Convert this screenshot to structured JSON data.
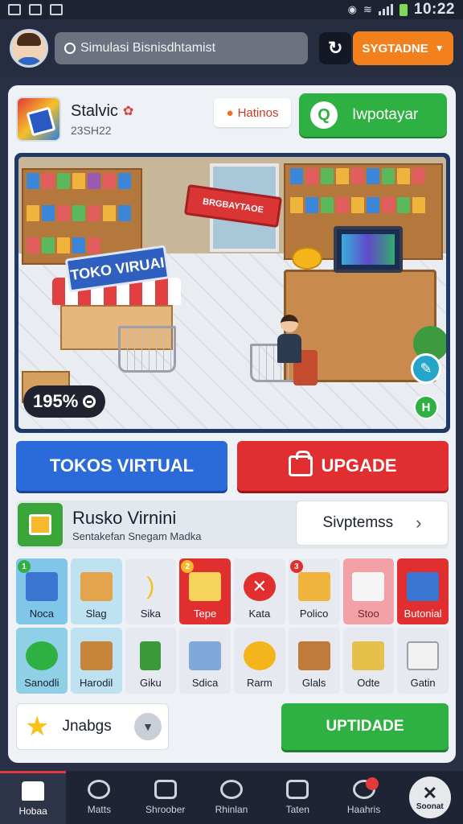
{
  "status": {
    "time": "10:22"
  },
  "topbar": {
    "search_text": "Simulasi Bisnisdhtamist",
    "sync_label": "SYGTADNE"
  },
  "app": {
    "name": "Stalvic",
    "sub": "23SH22",
    "hatinos_label": "Hatinos",
    "support_label": "Iwpotayar"
  },
  "scene": {
    "kiosk_sign": "TOKO VIRUAI",
    "red_sign": "BRGBAYTAOE",
    "progress_text": "195%"
  },
  "actions": {
    "tokos_label": "TOKOS VIRTUAL",
    "upgade_label": "UPGADE"
  },
  "info": {
    "title": "Rusko Virnini",
    "subtitle": "Sentakefan Snegam Madka",
    "support_label": "Sivptemss"
  },
  "grid": {
    "items": [
      {
        "label": "Noca",
        "icon": "box-icon",
        "badge": "1"
      },
      {
        "label": "Slag",
        "icon": "mug-icon",
        "badge": ""
      },
      {
        "label": "Sika",
        "icon": "banana-icon",
        "badge": ""
      },
      {
        "label": "Tepe",
        "icon": "book-icon",
        "badge": "2"
      },
      {
        "label": "Kata",
        "icon": "cancel-icon",
        "badge": ""
      },
      {
        "label": "Polico",
        "icon": "crate-icon",
        "badge": "3"
      },
      {
        "label": "Stoo",
        "icon": "stack-icon",
        "badge": ""
      },
      {
        "label": "Butonial",
        "icon": "toy-icon",
        "badge": ""
      },
      {
        "label": "Sanodli",
        "icon": "leaf-icon",
        "badge": ""
      },
      {
        "label": "Harodil",
        "icon": "cabinet-icon",
        "badge": ""
      },
      {
        "label": "Giku",
        "icon": "phone-icon",
        "badge": ""
      },
      {
        "label": "Sdica",
        "icon": "scanner-icon",
        "badge": ""
      },
      {
        "label": "Rarm",
        "icon": "coin-icon",
        "badge": ""
      },
      {
        "label": "Glals",
        "icon": "bread-icon",
        "badge": ""
      },
      {
        "label": "Odte",
        "icon": "package-icon",
        "badge": ""
      },
      {
        "label": "Gatin",
        "icon": "flask-icon",
        "badge": ""
      }
    ]
  },
  "bottom": {
    "favs_label": "Jnabgs",
    "upgrade_label": "UPTIDADE"
  },
  "nav": {
    "items": [
      {
        "label": "Hobaa"
      },
      {
        "label": "Matts"
      },
      {
        "label": "Shroober"
      },
      {
        "label": "Rhinlan"
      },
      {
        "label": "Taten"
      },
      {
        "label": "Haahris"
      }
    ],
    "close_label": "Soonat"
  }
}
